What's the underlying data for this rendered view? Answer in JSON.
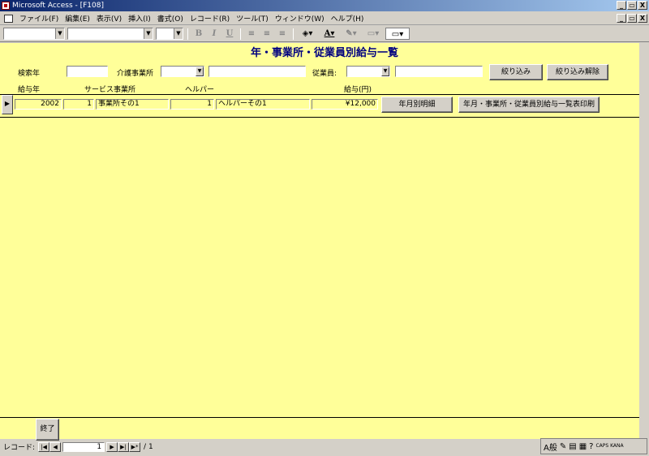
{
  "window": {
    "title": "Microsoft Access - [F108]"
  },
  "menu": [
    "ファイル(F)",
    "編集(E)",
    "表示(V)",
    "挿入(I)",
    "書式(O)",
    "レコード(R)",
    "ツール(T)",
    "ウィンドウ(W)",
    "ヘルプ(H)"
  ],
  "window_buttons": [
    "_",
    "🗗",
    "X"
  ],
  "toolbar": {
    "bold": "B",
    "italic": "I",
    "underline": "U"
  },
  "form": {
    "title": "年・事業所・従業員別給与一覧",
    "filters": {
      "search_year_label": "検索年",
      "care_office_label": "介護事業所",
      "employee_label": "従業員:",
      "filter_button": "絞り込み",
      "clear_filter_button": "絞り込み解除"
    },
    "columns": [
      "給与年",
      "サービス事業所",
      "ヘルパー",
      "給与(円)"
    ],
    "row": {
      "year": "2002",
      "office_no": "1",
      "office_name": "事業所その1",
      "helper_no": "1",
      "helper_name": "ヘルパーその1",
      "salary": "¥12,000"
    },
    "row_buttons": {
      "monthly_detail": "年月別明細",
      "print": "年月・事業所・従業員別給与一覧表印刷"
    },
    "close_button": "終了"
  },
  "navigation": {
    "label": "レコード:",
    "current": "1",
    "total": "/ 1"
  },
  "tray": {
    "ime": "A般",
    "caps": "CAPS KANA"
  }
}
